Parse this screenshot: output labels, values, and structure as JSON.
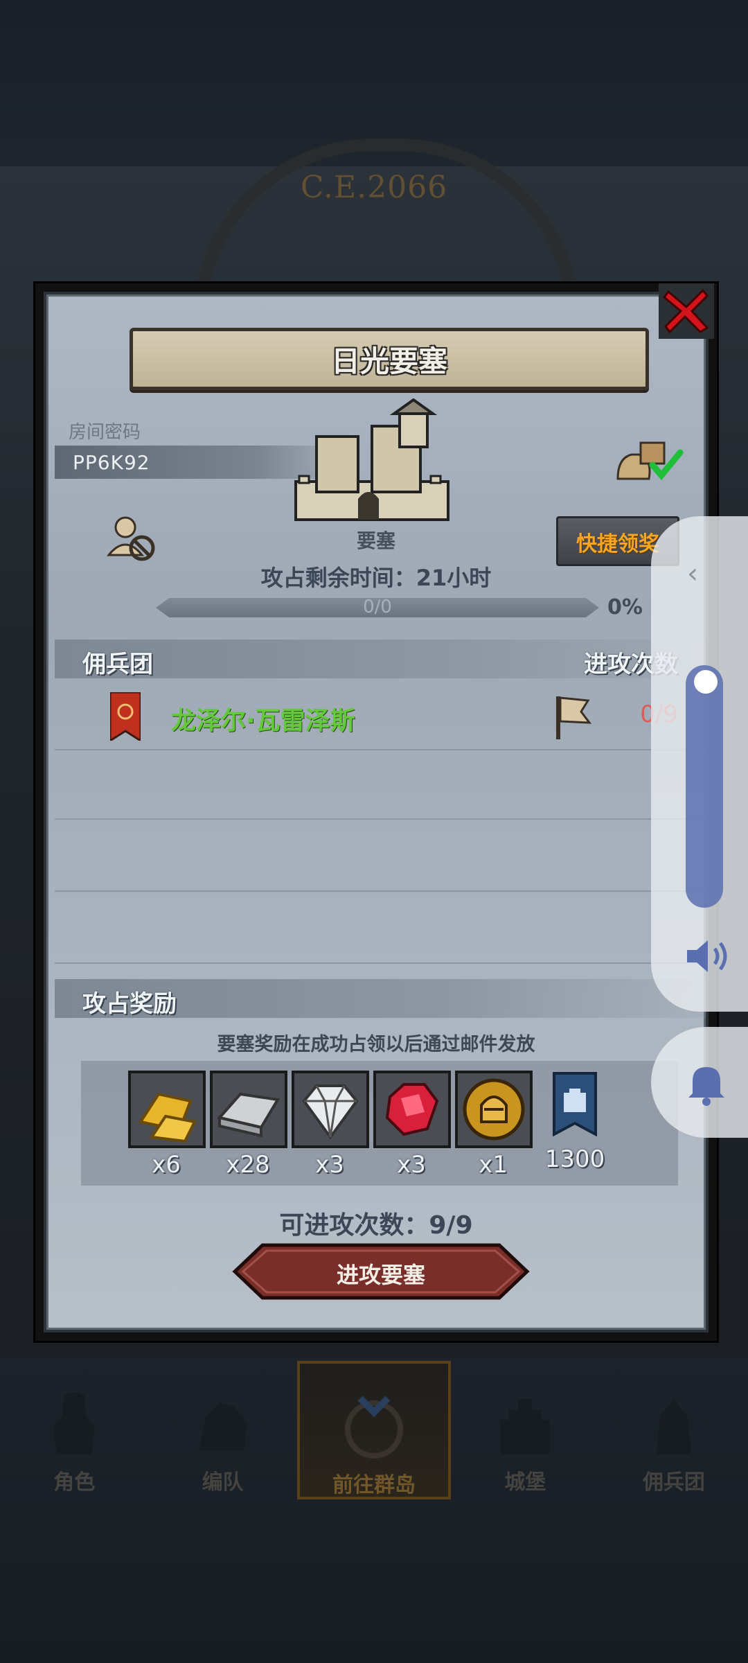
{
  "background": {
    "era_text": "C.E.2066"
  },
  "modal": {
    "title": "日光要塞",
    "room_label": "房间密码",
    "room_code": "PP6K92",
    "fortress_label": "要塞",
    "time_left": "攻占剩余时间：21小时",
    "progress": {
      "text": "0/0",
      "percent_label": "0%",
      "fraction": 0
    },
    "quick_claim_label": "快捷领奖",
    "mercenary_section": {
      "title": "佣兵团",
      "right_header": "进攻次数",
      "rows": [
        {
          "name": "龙泽尔·瓦雷泽斯",
          "count": "0/9"
        }
      ]
    },
    "reward_section": {
      "title": "攻占奖励",
      "note": "要塞奖励在成功占领以后通过邮件发放",
      "items": [
        {
          "icon": "gold-bar-icon",
          "qty": "x6"
        },
        {
          "icon": "iron-ingot-icon",
          "qty": "x28"
        },
        {
          "icon": "diamond-icon",
          "qty": "x3"
        },
        {
          "icon": "ruby-icon",
          "qty": "x3"
        },
        {
          "icon": "knight-coin-icon",
          "qty": "x1"
        },
        {
          "icon": "fortress-banner-icon",
          "qty": "1300"
        }
      ]
    },
    "attack_count": "可进攻次数：9/9",
    "attack_button_label": "进攻要塞"
  },
  "bottom_nav": {
    "items": [
      {
        "label": "角色",
        "active": false
      },
      {
        "label": "编队",
        "active": false
      },
      {
        "label": "前往群岛",
        "active": true
      },
      {
        "label": "城堡",
        "active": false
      },
      {
        "label": "佣兵团",
        "active": false
      }
    ]
  },
  "colors": {
    "accent_orange": "#f5a623",
    "merc_green": "#63c93a",
    "count_red": "#e05a5a",
    "attack_button": "#7a2e2a"
  }
}
